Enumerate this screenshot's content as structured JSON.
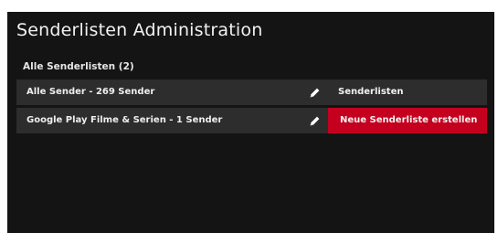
{
  "page": {
    "title": "Senderlisten Administration"
  },
  "section": {
    "title": "Alle Senderlisten (2)"
  },
  "lists": [
    {
      "label": "Alle Sender - 269 Sender",
      "edit_icon": "pencil-icon"
    },
    {
      "label": "Google Play Filme & Serien - 1 Sender",
      "edit_icon": "pencil-icon"
    }
  ],
  "actions": {
    "lists_label": "Senderlisten",
    "create_label": "Neue Senderliste erstellen"
  },
  "colors": {
    "background": "#141414",
    "row": "#2d2d2d",
    "accent": "#c4001e",
    "text": "#f2f2f2"
  }
}
